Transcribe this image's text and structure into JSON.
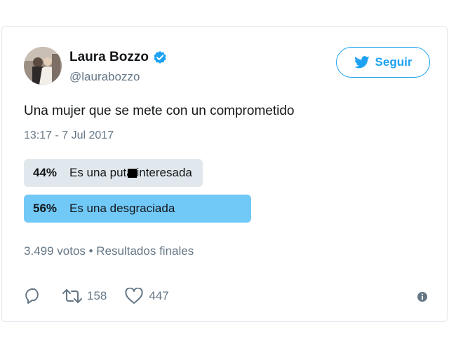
{
  "user": {
    "name": "Laura Bozzo",
    "handle": "@laurabozzo",
    "verified_icon": "verified-badge-icon"
  },
  "follow": {
    "label": "Seguir",
    "icon": "twitter-bird-icon"
  },
  "tweet": {
    "text": "Una mujer que se mete con un comprometido",
    "timestamp": "13:17 - 7 Jul 2017"
  },
  "poll": {
    "options": [
      {
        "percent_label": "44%",
        "percent": 44,
        "text": "Es una puta interesada",
        "leading": false
      },
      {
        "percent_label": "56%",
        "percent": 56,
        "text": "Es una desgraciada",
        "leading": true
      }
    ],
    "summary": "3.499 votos • Resultados finales"
  },
  "actions": {
    "reply_icon": "reply-icon",
    "retweet_icon": "retweet-icon",
    "retweet_count": "158",
    "like_icon": "heart-icon",
    "like_count": "447",
    "info_icon": "info-icon"
  },
  "colors": {
    "accent": "#1da1f2",
    "poll_leading": "#71c9f8",
    "poll_other": "#e1e8ed",
    "text": "#14171a",
    "muted": "#657786"
  }
}
